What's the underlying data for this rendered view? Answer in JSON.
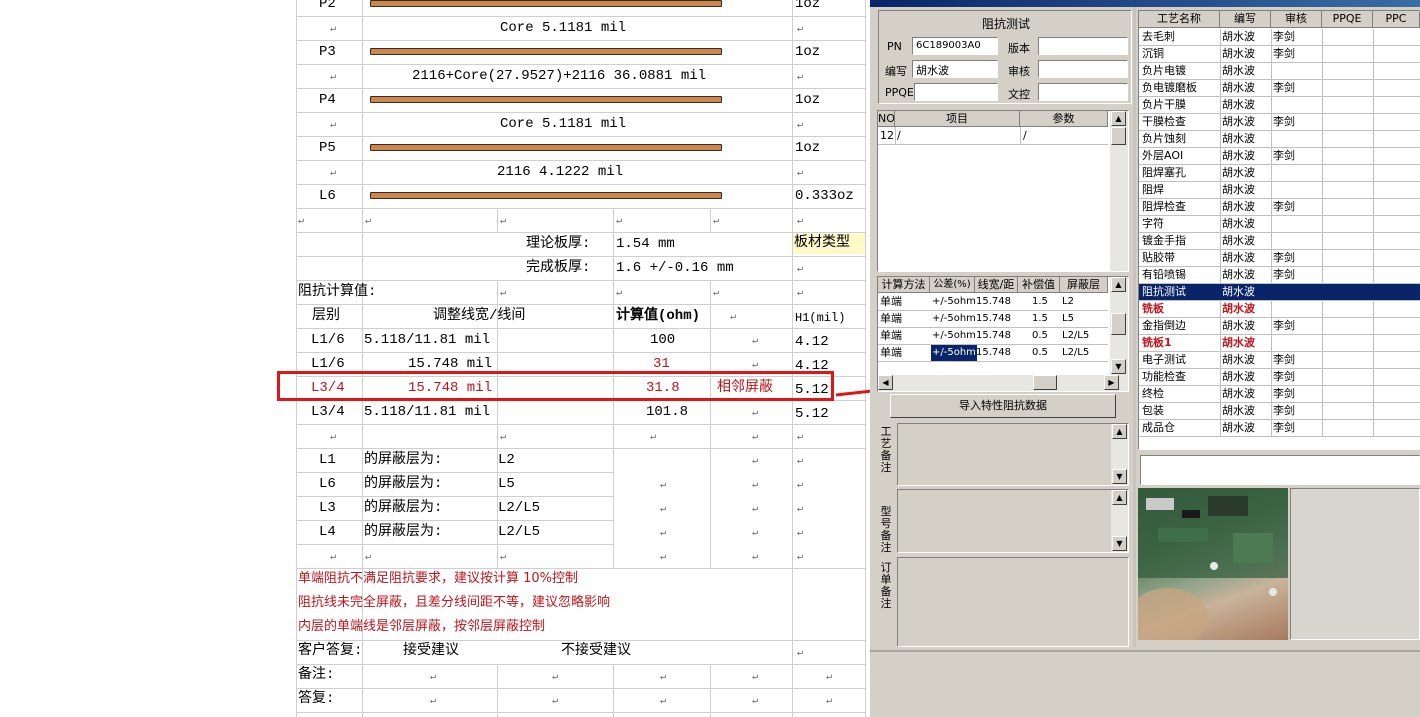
{
  "doc": {
    "p2": "P2",
    "p3": "P3",
    "p4": "P4",
    "p5": "P5",
    "l6": "L6",
    "core1": "Core   5.1181 mil",
    "pp1": "2116+Core(27.9527)+2116   36.0881 mil",
    "core2": "Core   5.1181 mil",
    "pp2": "2116    4.1222 mil",
    "oz_p2": "1oz",
    "oz_p3": "1oz",
    "oz_p4": "1oz",
    "oz_p5": "1oz",
    "oz_l6": "0.333oz",
    "thick_theory_label": "理论板厚:",
    "thick_theory_val": "1.54 mm",
    "board_type": "板材类型",
    "thick_final_label": "完成板厚:",
    "thick_final_val": "1.6 +/-0.16 mm",
    "calc_title": "阻抗计算值:",
    "col_layer": "层别",
    "col_width": "调整线宽/线间",
    "col_value": "计算值(ohm)",
    "col_h1": "H1(mil)",
    "rows": [
      {
        "layer": "L1/6",
        "width": "5.118/11.81 mil",
        "value": "100",
        "note": "",
        "h1": "4.12"
      },
      {
        "layer": "L1/6",
        "width": "15.748 mil",
        "value": "31",
        "note": "",
        "h1": "4.12"
      },
      {
        "layer": "L3/4",
        "width": "15.748 mil",
        "value": "31.8",
        "note": "相邻屏蔽",
        "h1": "5.12"
      },
      {
        "layer": "L3/4",
        "width": "5.118/11.81 mil",
        "value": "101.8",
        "note": "",
        "h1": "5.12"
      }
    ],
    "shield": [
      {
        "layer": "L1",
        "label": "的屏蔽层为:",
        "val": "L2"
      },
      {
        "layer": "L6",
        "label": "的屏蔽层为:",
        "val": "L5"
      },
      {
        "layer": "L3",
        "label": "的屏蔽层为:",
        "val": "L2/L5"
      },
      {
        "layer": "L4",
        "label": "的屏蔽层为:",
        "val": "L2/L5"
      }
    ],
    "notes": [
      "单端阻抗不满足阻抗要求，建议按计算 10%控制",
      "阻抗线未完全屏蔽，且差分线间距不等，建议忽略影响",
      "内层的单端线是邻层屏蔽，按邻层屏蔽控制"
    ],
    "reply_label": "客户答复:",
    "accept": "接受建议",
    "reject": "不接受建议",
    "remark_label": "备注:",
    "answer_label": "答复:"
  },
  "app": {
    "section_title": "阻抗测试",
    "pn_label": "PN",
    "pn_value": "6C189003A0",
    "version_label": "版本",
    "author_label": "编写",
    "author_value": "胡水波",
    "review_label": "审核",
    "ppqe_label": "PPQE",
    "doc_label": "文控",
    "grid1_cols": [
      "NO",
      "项目",
      "参数"
    ],
    "grid1_row": {
      "no": "12",
      "item": "/",
      "param": "/"
    },
    "grid2_cols": [
      "计算方法",
      "公差(%)",
      "线宽/距",
      "补偿值",
      "屏蔽层"
    ],
    "grid2_rows": [
      {
        "method": "单端",
        "tol": "+/-5ohm",
        "width": "15.748",
        "comp": "1.5",
        "shield": "L2"
      },
      {
        "method": "单端",
        "tol": "+/-5ohm",
        "width": "15.748",
        "comp": "1.5",
        "shield": "L5"
      },
      {
        "method": "单端",
        "tol": "+/-5ohm",
        "width": "15.748",
        "comp": "0.5",
        "shield": "L2/L5"
      },
      {
        "method": "单端",
        "tol": "+/-5ohm",
        "width": "15.748",
        "comp": "0.5",
        "shield": "L2/L5"
      }
    ],
    "import_btn": "导入特性阻抗数据",
    "memo1": "工艺备注",
    "memo2": "型号备注",
    "memo3": "订单备注",
    "proc_cols": [
      "工艺名称",
      "编写",
      "审核",
      "PPQE",
      "PPC"
    ],
    "processes": [
      {
        "name": "去毛刺",
        "author": "胡水波",
        "review": "李剑",
        "style": ""
      },
      {
        "name": "沉铜",
        "author": "胡水波",
        "review": "李剑",
        "style": ""
      },
      {
        "name": "负片电镀",
        "author": "胡水波",
        "review": "",
        "style": ""
      },
      {
        "name": "负电镀磨板",
        "author": "胡水波",
        "review": "李剑",
        "style": ""
      },
      {
        "name": "负片干膜",
        "author": "胡水波",
        "review": "",
        "style": ""
      },
      {
        "name": "干膜检查",
        "author": "胡水波",
        "review": "李剑",
        "style": ""
      },
      {
        "name": "负片蚀刻",
        "author": "胡水波",
        "review": "",
        "style": ""
      },
      {
        "name": "外层AOI",
        "author": "胡水波",
        "review": "李剑",
        "style": ""
      },
      {
        "name": "阻焊塞孔",
        "author": "胡水波",
        "review": "",
        "style": ""
      },
      {
        "name": "阻焊",
        "author": "胡水波",
        "review": "",
        "style": ""
      },
      {
        "name": "阻焊检查",
        "author": "胡水波",
        "review": "李剑",
        "style": ""
      },
      {
        "name": "字符",
        "author": "胡水波",
        "review": "",
        "style": ""
      },
      {
        "name": "镀金手指",
        "author": "胡水波",
        "review": "",
        "style": ""
      },
      {
        "name": "贴胶带",
        "author": "胡水波",
        "review": "李剑",
        "style": ""
      },
      {
        "name": "有铅喷锡",
        "author": "胡水波",
        "review": "李剑",
        "style": ""
      },
      {
        "name": "阻抗测试",
        "author": "胡水波",
        "review": "",
        "style": "sel"
      },
      {
        "name": "铣板",
        "author": "胡水波",
        "review": "",
        "style": "red"
      },
      {
        "name": "金指倒边",
        "author": "胡水波",
        "review": "李剑",
        "style": ""
      },
      {
        "name": "铣板1",
        "author": "胡水波",
        "review": "",
        "style": "red"
      },
      {
        "name": "电子测试",
        "author": "胡水波",
        "review": "李剑",
        "style": ""
      },
      {
        "name": "功能检查",
        "author": "胡水波",
        "review": "李剑",
        "style": ""
      },
      {
        "name": "终检",
        "author": "胡水波",
        "review": "李剑",
        "style": ""
      },
      {
        "name": "包装",
        "author": "胡水波",
        "review": "李剑",
        "style": ""
      },
      {
        "name": "成品仓",
        "author": "胡水波",
        "review": "李剑",
        "style": ""
      }
    ]
  },
  "colors": {
    "highlight": "#e01515",
    "select": "#0a246a",
    "red_text": "#c0161c",
    "copper": "#c8874f"
  }
}
